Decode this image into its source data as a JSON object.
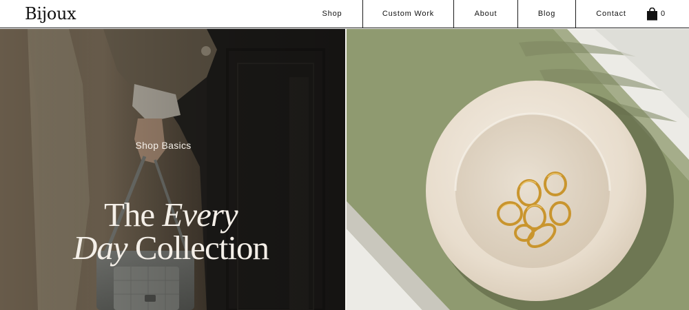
{
  "brand": {
    "name": "Bijoux"
  },
  "nav": {
    "items": [
      {
        "label": "Shop"
      },
      {
        "label": "Custom Work"
      },
      {
        "label": "About"
      },
      {
        "label": "Blog"
      },
      {
        "label": "Contact"
      }
    ],
    "cart": {
      "count": "0",
      "icon": "shopping-bag-icon"
    }
  },
  "hero": {
    "eyebrow": "Shop Basics",
    "headline": {
      "line1_regular": "The ",
      "line1_italic": "Every",
      "line2_italic": "Day",
      "line2_regular": " Collection"
    }
  },
  "colors": {
    "header_bg": "#ffffff",
    "text_dark": "#111111",
    "hero_text": "#f4efe8",
    "sage_board": "#8e9a6f",
    "dish": "#ede4d8",
    "gold": "#c9952e"
  }
}
